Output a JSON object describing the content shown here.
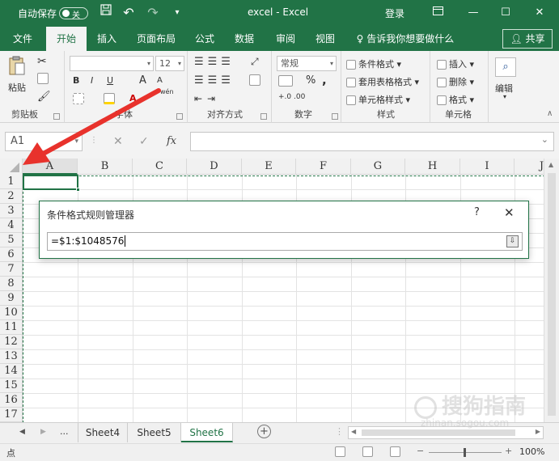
{
  "titlebar": {
    "autosave_label": "自动保存",
    "autosave_state": "关",
    "title": "excel  -  Excel",
    "login": "登录"
  },
  "tabs": [
    "文件",
    "开始",
    "插入",
    "页面布局",
    "公式",
    "数据",
    "审阅",
    "视图"
  ],
  "active_tab": "开始",
  "tell_me": "告诉我你想要做什么",
  "share": "共享",
  "ribbon": {
    "clipboard": {
      "paste": "粘贴",
      "label": "剪贴板"
    },
    "font": {
      "size": "12",
      "label": "字体",
      "bold": "B",
      "italic": "I",
      "underline": "U",
      "wen": "wén",
      "grow": "A",
      "shrink": "A"
    },
    "alignment": {
      "label": "对齐方式"
    },
    "number": {
      "format": "常规",
      "percent": "%",
      "comma": ",",
      "label": "数字"
    },
    "styles": {
      "cond_format": "条件格式",
      "table_format": "套用表格格式",
      "cell_style": "单元格样式",
      "label": "样式"
    },
    "cells": {
      "insert": "插入",
      "delete": "删除",
      "format": "格式",
      "label": "单元格"
    },
    "editing": {
      "label": "编辑"
    }
  },
  "formula_bar": {
    "name_box": "A1",
    "fx": "fx",
    "value": ""
  },
  "columns": [
    "A",
    "B",
    "C",
    "D",
    "E",
    "F",
    "G",
    "H",
    "I",
    "J"
  ],
  "rows": [
    "1",
    "2",
    "3",
    "4",
    "5",
    "6",
    "7",
    "8",
    "9",
    "10",
    "11",
    "12",
    "13",
    "14",
    "15",
    "16",
    "17"
  ],
  "dialog": {
    "title": "条件格式规则管理器",
    "help": "?",
    "close": "✕",
    "input_value": "=$1:$1048576"
  },
  "sheets": [
    "Sheet4",
    "Sheet5",
    "Sheet6"
  ],
  "active_sheet": "Sheet6",
  "sheet_more": "...",
  "status": {
    "mode": "点",
    "zoom": "100%"
  },
  "watermark": {
    "text": "搜狗指南",
    "url": "zhinan.sogou.com"
  },
  "colors": {
    "excel_green": "#217346",
    "arrow_red": "#e8322c"
  }
}
